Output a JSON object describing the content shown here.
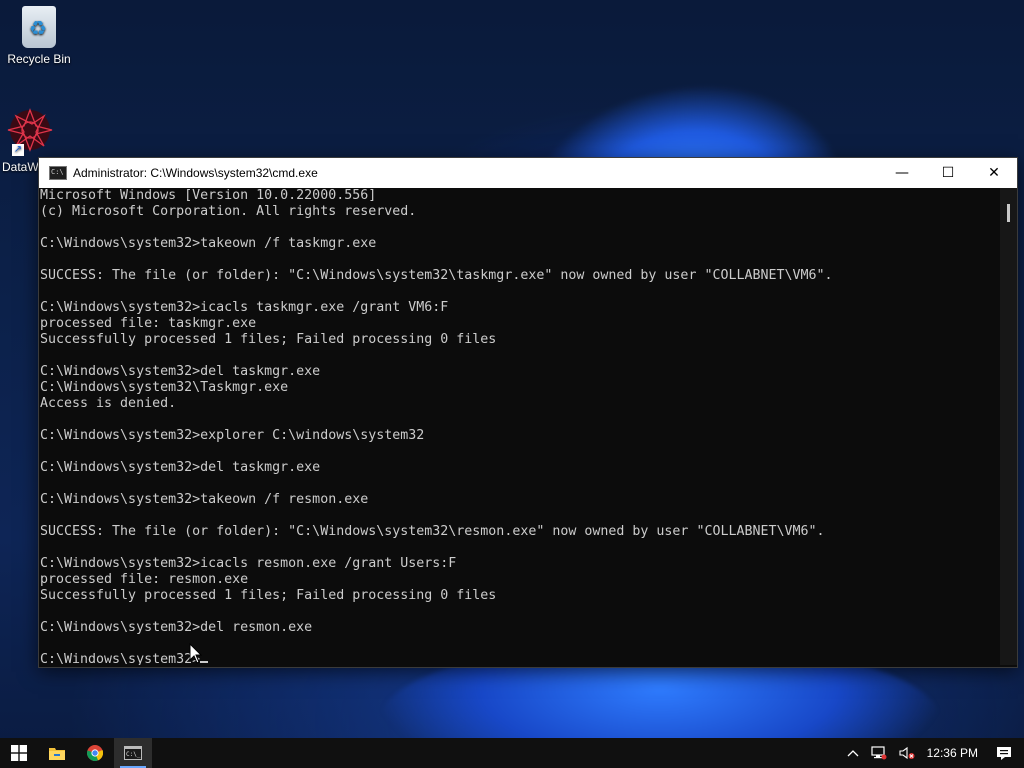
{
  "desktop": {
    "icons": [
      {
        "label": "Recycle Bin",
        "icon": "recycle-bin-icon"
      },
      {
        "label": "DataW",
        "icon": "datawarrior-icon"
      }
    ]
  },
  "window": {
    "title": "Administrator: C:\\Windows\\system32\\cmd.exe",
    "minimize_glyph": "—",
    "maximize_glyph": "☐",
    "close_glyph": "✕"
  },
  "console": {
    "lines": [
      "Microsoft Windows [Version 10.0.22000.556]",
      "(c) Microsoft Corporation. All rights reserved.",
      "",
      "C:\\Windows\\system32>takeown /f taskmgr.exe",
      "",
      "SUCCESS: The file (or folder): \"C:\\Windows\\system32\\taskmgr.exe\" now owned by user \"COLLABNET\\VM6\".",
      "",
      "C:\\Windows\\system32>icacls taskmgr.exe /grant VM6:F",
      "processed file: taskmgr.exe",
      "Successfully processed 1 files; Failed processing 0 files",
      "",
      "C:\\Windows\\system32>del taskmgr.exe",
      "C:\\Windows\\system32\\Taskmgr.exe",
      "Access is denied.",
      "",
      "C:\\Windows\\system32>explorer C:\\windows\\system32",
      "",
      "C:\\Windows\\system32>del taskmgr.exe",
      "",
      "C:\\Windows\\system32>takeown /f resmon.exe",
      "",
      "SUCCESS: The file (or folder): \"C:\\Windows\\system32\\resmon.exe\" now owned by user \"COLLABNET\\VM6\".",
      "",
      "C:\\Windows\\system32>icacls resmon.exe /grant Users:F",
      "processed file: resmon.exe",
      "Successfully processed 1 files; Failed processing 0 files",
      "",
      "C:\\Windows\\system32>del resmon.exe",
      ""
    ],
    "prompt": "C:\\Windows\\system32>"
  },
  "taskbar": {
    "items": [
      {
        "name": "start-button",
        "icon": "windows-logo-icon"
      },
      {
        "name": "file-explorer-button",
        "icon": "folder-icon"
      },
      {
        "name": "chrome-button",
        "icon": "chrome-icon"
      },
      {
        "name": "cmd-button",
        "icon": "cmd-icon",
        "active": true
      }
    ],
    "tray": {
      "clock": "12:36 PM",
      "icons": [
        "chevron-up-icon",
        "network-icon",
        "volume-muted-icon",
        "notifications-icon"
      ]
    }
  },
  "colors": {
    "console_bg": "#0c0c0c",
    "console_fg": "#cccccc",
    "titlebar_bg": "#ffffff",
    "taskbar_bg": "#101010",
    "accent": "#6aa8ff"
  }
}
